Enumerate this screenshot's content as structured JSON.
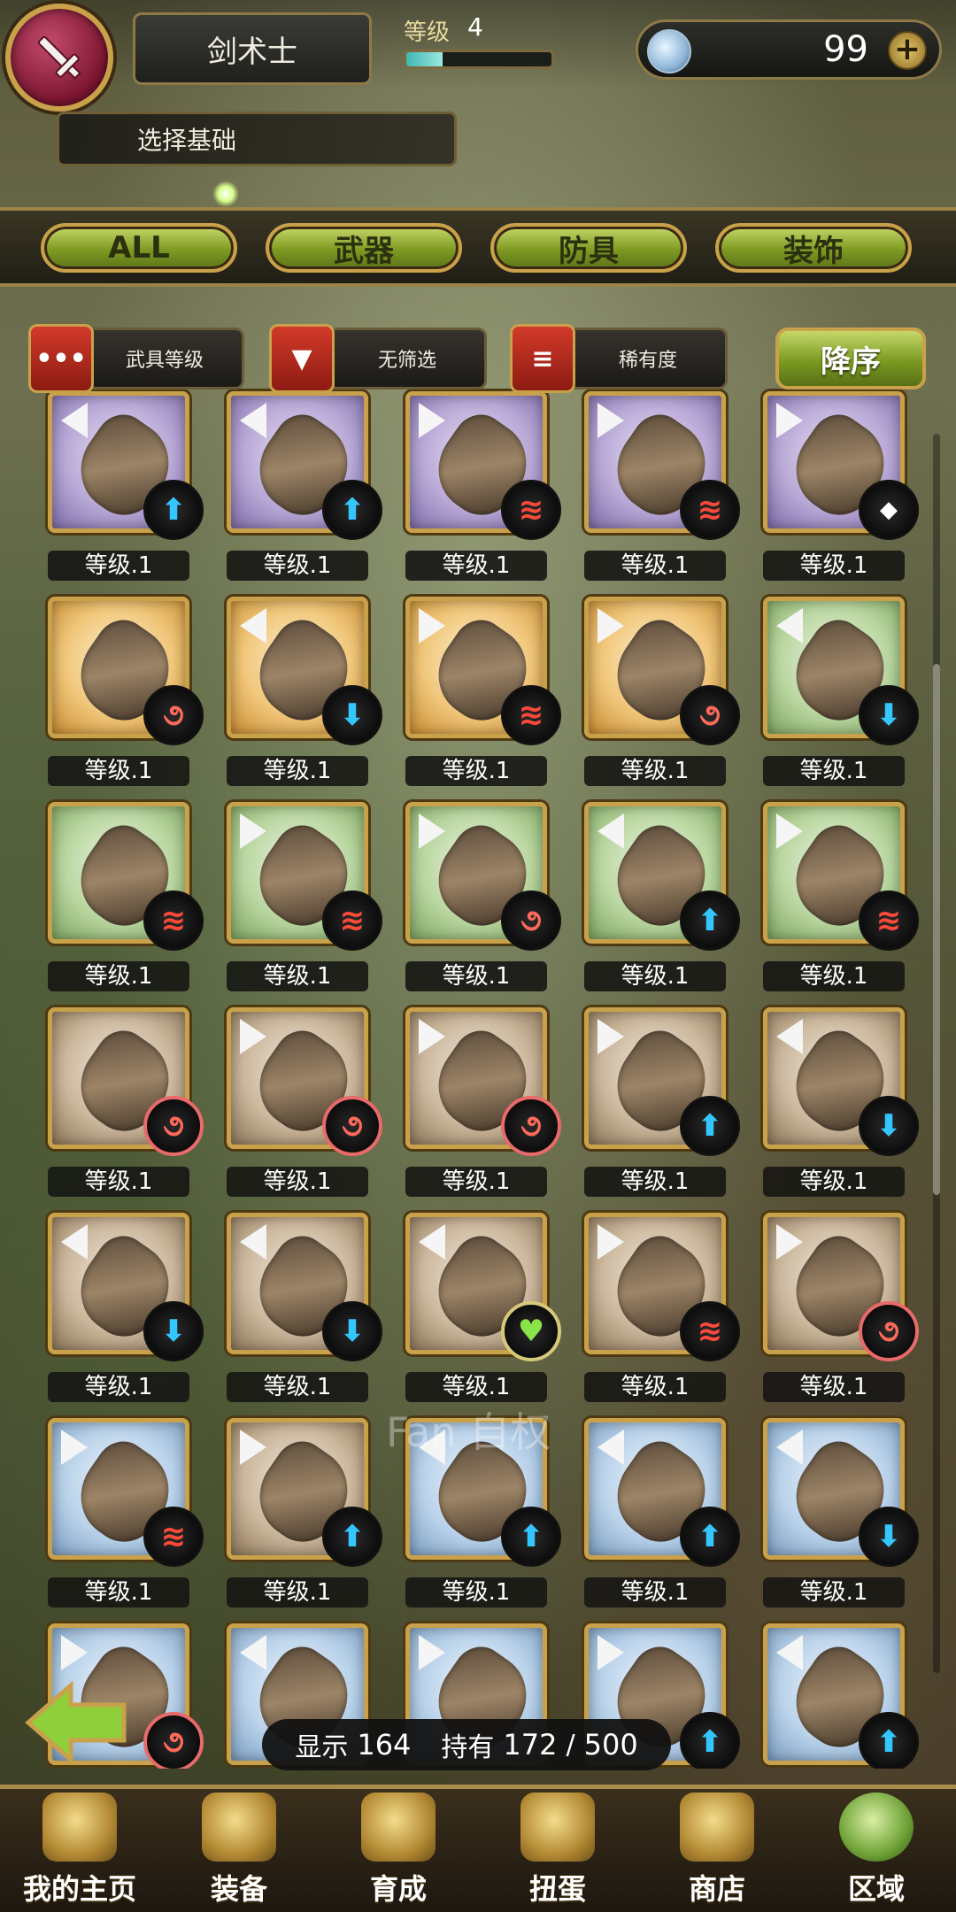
{
  "header": {
    "class_name": "剑术士",
    "level_label": "等级",
    "level_value": "4",
    "level_progress": 0.25,
    "gem_count": "99",
    "gem_plus": "+",
    "subtitle": "选择基础"
  },
  "tabs": [
    {
      "label": "ALL"
    },
    {
      "label": "武器"
    },
    {
      "label": "防具"
    },
    {
      "label": "装饰"
    }
  ],
  "sort": {
    "rank_badge": "•••",
    "rank_label": "武具等级",
    "filter_badge": "▼",
    "filter_label": "无筛选",
    "rarity_badge": "≡",
    "rarity_label": "稀有度",
    "order_button": "降序"
  },
  "grid": {
    "level_text": "等级.1",
    "items": [
      {
        "color": "purple",
        "arrow": "left",
        "badge": "up"
      },
      {
        "color": "purple",
        "arrow": "left",
        "badge": "up"
      },
      {
        "color": "purple",
        "arrow": "right",
        "badge": "fire"
      },
      {
        "color": "purple",
        "arrow": "right",
        "badge": "fire"
      },
      {
        "color": "purple",
        "arrow": "right",
        "badge": "diamond"
      },
      {
        "color": "orange",
        "arrow": "none",
        "badge": "swirl"
      },
      {
        "color": "orange",
        "arrow": "left",
        "badge": "down"
      },
      {
        "color": "orange",
        "arrow": "right",
        "badge": "fire"
      },
      {
        "color": "orange",
        "arrow": "right",
        "badge": "swirl"
      },
      {
        "color": "green",
        "arrow": "left",
        "badge": "down"
      },
      {
        "color": "green",
        "arrow": "none",
        "badge": "fire"
      },
      {
        "color": "green",
        "arrow": "right",
        "badge": "fire"
      },
      {
        "color": "green",
        "arrow": "right",
        "badge": "swirl"
      },
      {
        "color": "green",
        "arrow": "left",
        "badge": "up"
      },
      {
        "color": "green",
        "arrow": "right",
        "badge": "fire"
      },
      {
        "color": "brown",
        "arrow": "none",
        "badge": "swirl-ring"
      },
      {
        "color": "brown",
        "arrow": "right",
        "badge": "swirl-ring"
      },
      {
        "color": "brown",
        "arrow": "right",
        "badge": "swirl-ring"
      },
      {
        "color": "brown",
        "arrow": "right",
        "badge": "up"
      },
      {
        "color": "brown",
        "arrow": "left",
        "badge": "down"
      },
      {
        "color": "brown",
        "arrow": "left",
        "badge": "down"
      },
      {
        "color": "brown",
        "arrow": "left",
        "badge": "down"
      },
      {
        "color": "brown",
        "arrow": "left",
        "badge": "heart"
      },
      {
        "color": "brown",
        "arrow": "right",
        "badge": "fire"
      },
      {
        "color": "brown",
        "arrow": "right",
        "badge": "swirl-ring"
      },
      {
        "color": "blue",
        "arrow": "right",
        "badge": "fire"
      },
      {
        "color": "brown",
        "arrow": "right",
        "badge": "up"
      },
      {
        "color": "blue",
        "arrow": "left",
        "badge": "up"
      },
      {
        "color": "blue",
        "arrow": "left",
        "badge": "up"
      },
      {
        "color": "blue",
        "arrow": "left",
        "badge": "down"
      },
      {
        "color": "blue",
        "arrow": "right",
        "badge": "swirl-ring"
      },
      {
        "color": "blue",
        "arrow": "left",
        "badge": "none"
      },
      {
        "color": "blue",
        "arrow": "right",
        "badge": "none"
      },
      {
        "color": "blue",
        "arrow": "right",
        "badge": "up"
      },
      {
        "color": "blue",
        "arrow": "left",
        "badge": "up"
      }
    ]
  },
  "status": {
    "display_label": "显示",
    "display_count": "164",
    "owned_label": "持有",
    "owned_count": "172",
    "separator": "/",
    "max_count": "500"
  },
  "watermark": "Fan 自权",
  "bottom_nav": [
    {
      "label": "我的主页",
      "icon": "scroll-icon"
    },
    {
      "label": "装备",
      "icon": "helmet-icon"
    },
    {
      "label": "育成",
      "icon": "crossed-swords-icon"
    },
    {
      "label": "扭蛋",
      "icon": "gacha-icon"
    },
    {
      "label": "商店",
      "icon": "shop-icon"
    },
    {
      "label": "区域",
      "icon": "globe-icon",
      "active": true
    }
  ]
}
